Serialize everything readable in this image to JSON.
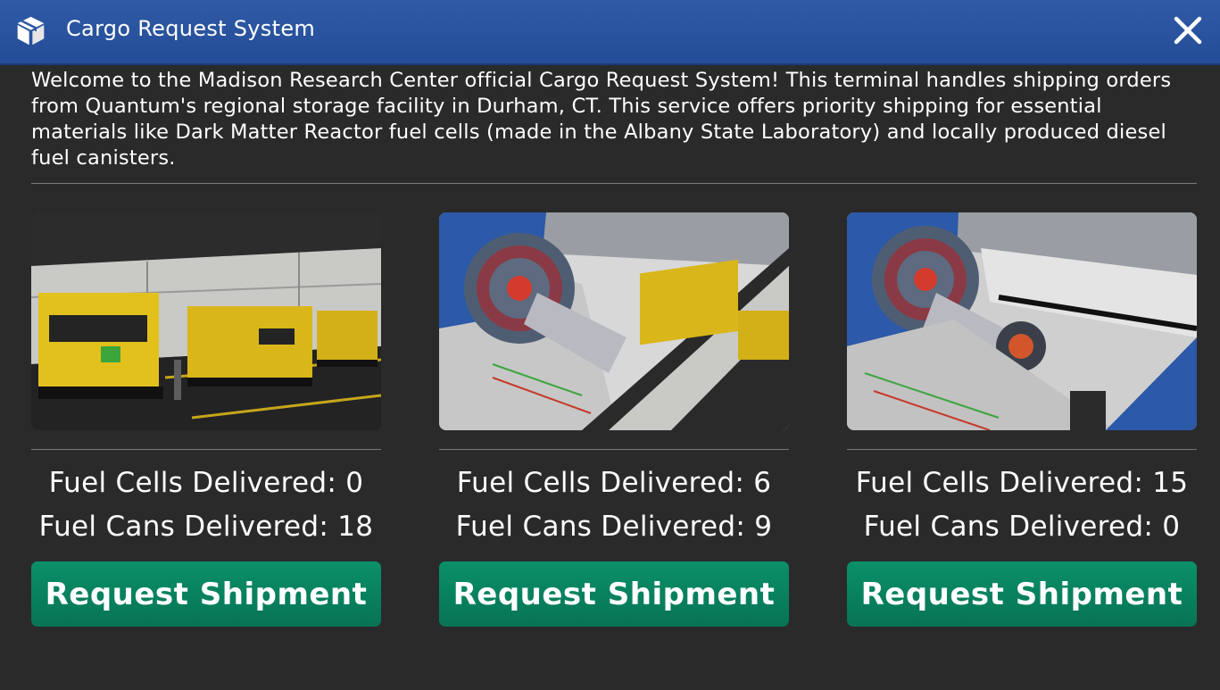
{
  "window": {
    "title": "Cargo Request System",
    "icon": "package-box-icon",
    "close_icon": "close-x-icon"
  },
  "intro": {
    "text": "Welcome to the Madison Research Center official Cargo Request System! This terminal handles shipping orders from Quantum's regional storage facility in Durham, CT. This service offers priority shipping for essential materials like Dark Matter Reactor fuel cells (made in the Albany State Laboratory) and locally produced diesel fuel canisters."
  },
  "cards": [
    {
      "cells": "Fuel Cells Delivered: 0",
      "cans": "Fuel Cans Delivered: 18",
      "button": "Request Shipment"
    },
    {
      "cells": "Fuel Cells Delivered: 6",
      "cans": "Fuel Cans Delivered: 9",
      "button": "Request Shipment"
    },
    {
      "cells": "Fuel Cells Delivered: 15",
      "cans": "Fuel Cans Delivered: 0",
      "button": "Request Shipment"
    }
  ],
  "colors": {
    "titlebar": "#2b559f",
    "background": "#2a2a2b",
    "button": "#088162"
  }
}
